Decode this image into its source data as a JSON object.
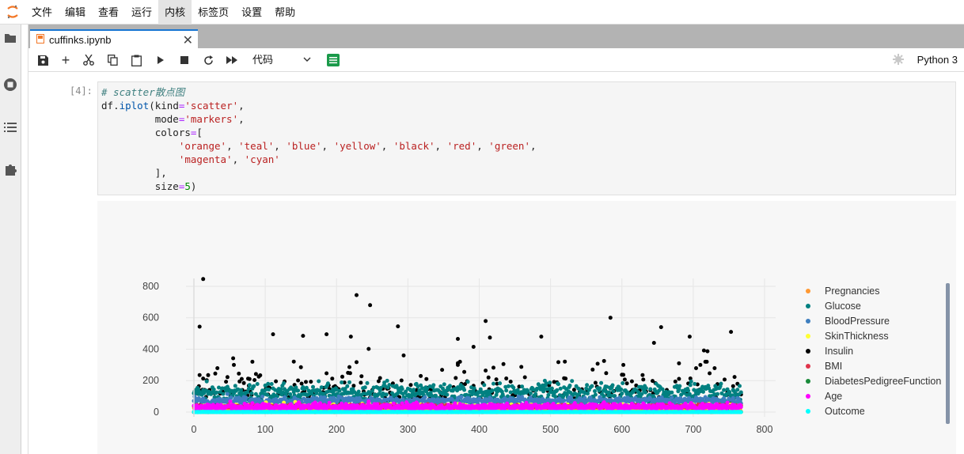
{
  "menu": [
    "文件",
    "编辑",
    "查看",
    "运行",
    "内核",
    "标签页",
    "设置",
    "帮助"
  ],
  "menu_active_index": 4,
  "tab": {
    "title": "cuffinks.ipynb",
    "close": "✕"
  },
  "toolbar": {
    "cell_type": "代码",
    "kernel": "Python 3"
  },
  "cell": {
    "prompt": "[4]:",
    "code_lines": [
      [
        [
          "c-comment",
          "# scatter散点图"
        ]
      ],
      [
        [
          "",
          "df"
        ],
        [
          "",
          "."
        ],
        [
          "c-name",
          "iplot"
        ],
        [
          "",
          "(kind"
        ],
        [
          "c-op",
          "="
        ],
        [
          "c-str",
          "'scatter'"
        ],
        [
          "",
          ","
        ]
      ],
      [
        [
          "",
          "         mode"
        ],
        [
          "c-op",
          "="
        ],
        [
          "c-str",
          "'markers'"
        ],
        [
          "",
          ","
        ]
      ],
      [
        [
          "",
          "         colors"
        ],
        [
          "c-op",
          "="
        ],
        [
          "",
          "["
        ]
      ],
      [
        [
          "",
          "             "
        ],
        [
          "c-str",
          "'orange'"
        ],
        [
          "",
          ", "
        ],
        [
          "c-str",
          "'teal'"
        ],
        [
          "",
          ", "
        ],
        [
          "c-str",
          "'blue'"
        ],
        [
          "",
          ", "
        ],
        [
          "c-str",
          "'yellow'"
        ],
        [
          "",
          ", "
        ],
        [
          "c-str",
          "'black'"
        ],
        [
          "",
          ", "
        ],
        [
          "c-str",
          "'red'"
        ],
        [
          "",
          ", "
        ],
        [
          "c-str",
          "'green'"
        ],
        [
          "",
          ","
        ]
      ],
      [
        [
          "",
          "             "
        ],
        [
          "c-str",
          "'magenta'"
        ],
        [
          "",
          ", "
        ],
        [
          "c-str",
          "'cyan'"
        ]
      ],
      [
        [
          "",
          "         ],"
        ]
      ],
      [
        [
          "",
          "         size"
        ],
        [
          "c-op",
          "="
        ],
        [
          "c-num",
          "5"
        ],
        [
          "",
          ")"
        ]
      ]
    ]
  },
  "chart_data": {
    "type": "scatter",
    "mode": "markers",
    "xlim": [
      0,
      800
    ],
    "ylim": [
      0,
      850
    ],
    "xticks": [
      0,
      100,
      200,
      300,
      400,
      500,
      600,
      700,
      800
    ],
    "yticks": [
      0,
      200,
      400,
      600,
      800
    ],
    "n_points": 768,
    "series": [
      {
        "name": "Pregnancies",
        "color": "#ff9933",
        "range": [
          0,
          17
        ]
      },
      {
        "name": "Glucose",
        "color": "#008080",
        "range": [
          0,
          199
        ]
      },
      {
        "name": "BloodPressure",
        "color": "#3f7fbf",
        "range": [
          0,
          122
        ]
      },
      {
        "name": "SkinThickness",
        "color": "#ffff33",
        "range": [
          0,
          99
        ]
      },
      {
        "name": "Insulin",
        "color": "#000000",
        "range": [
          0,
          846
        ]
      },
      {
        "name": "BMI",
        "color": "#e0344b",
        "range": [
          0,
          67
        ]
      },
      {
        "name": "DiabetesPedigreeFunction",
        "color": "#1a8a3a",
        "range": [
          0,
          2.4
        ]
      },
      {
        "name": "Age",
        "color": "#ff00ff",
        "range": [
          21,
          81
        ]
      },
      {
        "name": "Outcome",
        "color": "#00ffff",
        "range": [
          0,
          1
        ]
      }
    ],
    "insulin_outliers": [
      [
        13,
        846
      ],
      [
        8,
        543
      ],
      [
        111,
        495
      ],
      [
        153,
        485
      ],
      [
        186,
        495
      ],
      [
        228,
        744
      ],
      [
        247,
        680
      ],
      [
        286,
        545
      ],
      [
        220,
        480
      ],
      [
        409,
        579
      ],
      [
        415,
        474
      ],
      [
        584,
        600
      ],
      [
        655,
        540
      ],
      [
        695,
        480
      ],
      [
        753,
        510
      ],
      [
        370,
        465
      ],
      [
        487,
        480
      ],
      [
        645,
        440
      ],
      [
        715,
        392
      ],
      [
        720,
        387
      ],
      [
        294,
        360
      ],
      [
        392,
        415
      ],
      [
        245,
        402
      ],
      [
        55,
        342
      ],
      [
        56,
        300
      ],
      [
        150,
        285
      ],
      [
        140,
        321
      ],
      [
        370,
        300
      ],
      [
        710,
        300
      ],
      [
        520,
        321
      ],
      [
        575,
        325
      ],
      [
        602,
        300
      ],
      [
        680,
        310
      ],
      [
        20,
        235
      ],
      [
        30,
        245
      ]
    ]
  }
}
